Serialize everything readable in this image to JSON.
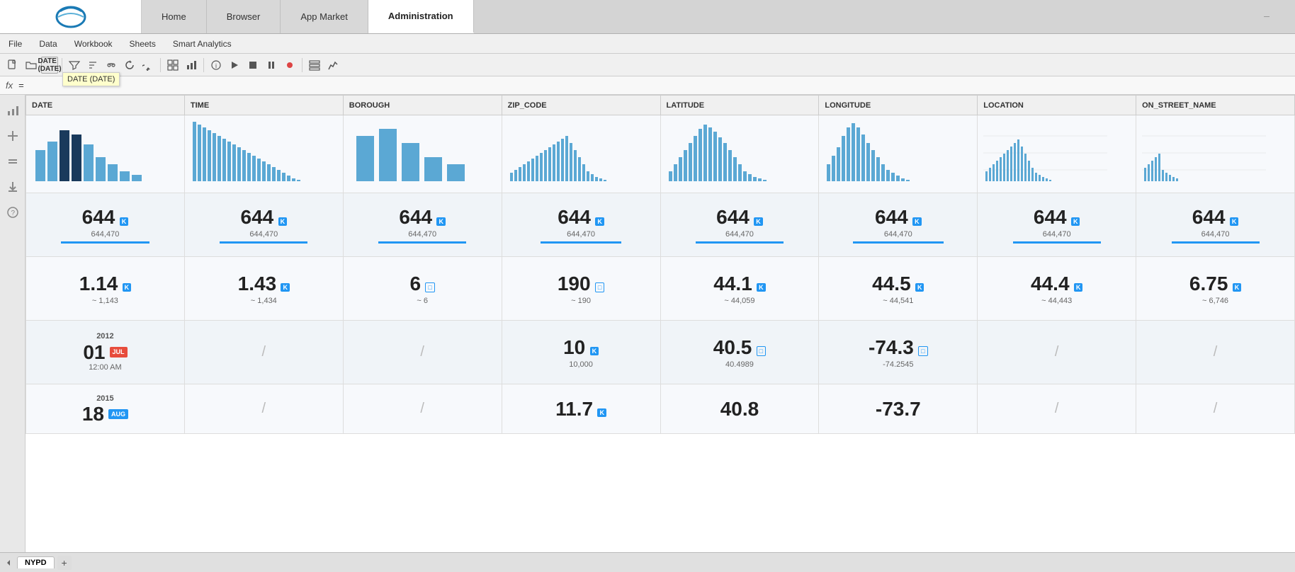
{
  "nav": {
    "tabs": [
      {
        "id": "home",
        "label": "Home",
        "active": false
      },
      {
        "id": "browser",
        "label": "Browser",
        "active": false
      },
      {
        "id": "appmarket",
        "label": "App Market",
        "active": false
      },
      {
        "id": "administration",
        "label": "Administration",
        "active": true
      }
    ]
  },
  "menu": {
    "items": [
      "File",
      "Data",
      "Workbook",
      "Sheets",
      "Smart Analytics"
    ]
  },
  "toolbar": {
    "tooltip": "DATE (DATE)"
  },
  "formula": {
    "label": "fx",
    "equals": "="
  },
  "columns": [
    {
      "id": "date",
      "label": "DATE"
    },
    {
      "id": "time",
      "label": "TIME"
    },
    {
      "id": "borough",
      "label": "BOROUGH"
    },
    {
      "id": "zip_code",
      "label": "ZIP_CODE"
    },
    {
      "id": "latitude",
      "label": "LATITUDE"
    },
    {
      "id": "longitude",
      "label": "LONGITUDE"
    },
    {
      "id": "location",
      "label": "LOCATION"
    },
    {
      "id": "on_street",
      "label": "ON_STREET_NAME"
    }
  ],
  "rows": {
    "count": {
      "value": "644",
      "badge": "K",
      "subvalue": "644,470",
      "show_bar": true
    },
    "avg": {
      "date": {
        "value": "1.14",
        "badge": "K",
        "sub": "~ 1,143"
      },
      "time": {
        "value": "1.43",
        "badge": "K",
        "sub": "~ 1,434"
      },
      "borough": {
        "value": "6",
        "badge": "□",
        "sub": "~ 6"
      },
      "zip_code": {
        "value": "190",
        "badge": "□",
        "sub": "~ 190"
      },
      "latitude": {
        "value": "44.1",
        "badge": "K",
        "sub": "~ 44,059"
      },
      "longitude": {
        "value": "44.5",
        "badge": "K",
        "sub": "~ 44,541"
      },
      "location": {
        "value": "44.4",
        "badge": "K",
        "sub": "~ 44,443"
      },
      "on_street": {
        "value": "6.75",
        "badge": "K",
        "sub": "~ 6,746"
      }
    },
    "sample1": {
      "date": {
        "year": "2012",
        "day": "01",
        "month": "JUL",
        "time": "12:00 AM"
      },
      "zip_code": {
        "value": "10",
        "badge": "K",
        "sub": "10,000"
      },
      "latitude": {
        "value": "40.5",
        "badge": "□",
        "sub": "40.4989"
      },
      "longitude": {
        "value": "-74.3",
        "badge": "□",
        "sub": "-74.2545"
      }
    },
    "sample2": {
      "date": {
        "year": "2015",
        "day": "18",
        "month": "AUG"
      },
      "zip_code": {
        "value": "11.7",
        "badge": "K"
      },
      "latitude": {
        "value": "40.8"
      },
      "longitude": {
        "value": "-73.7"
      }
    }
  },
  "bottom_tabs": {
    "sheets": [
      {
        "id": "nypd",
        "label": "NYPD",
        "active": true
      }
    ],
    "add_label": "+"
  }
}
